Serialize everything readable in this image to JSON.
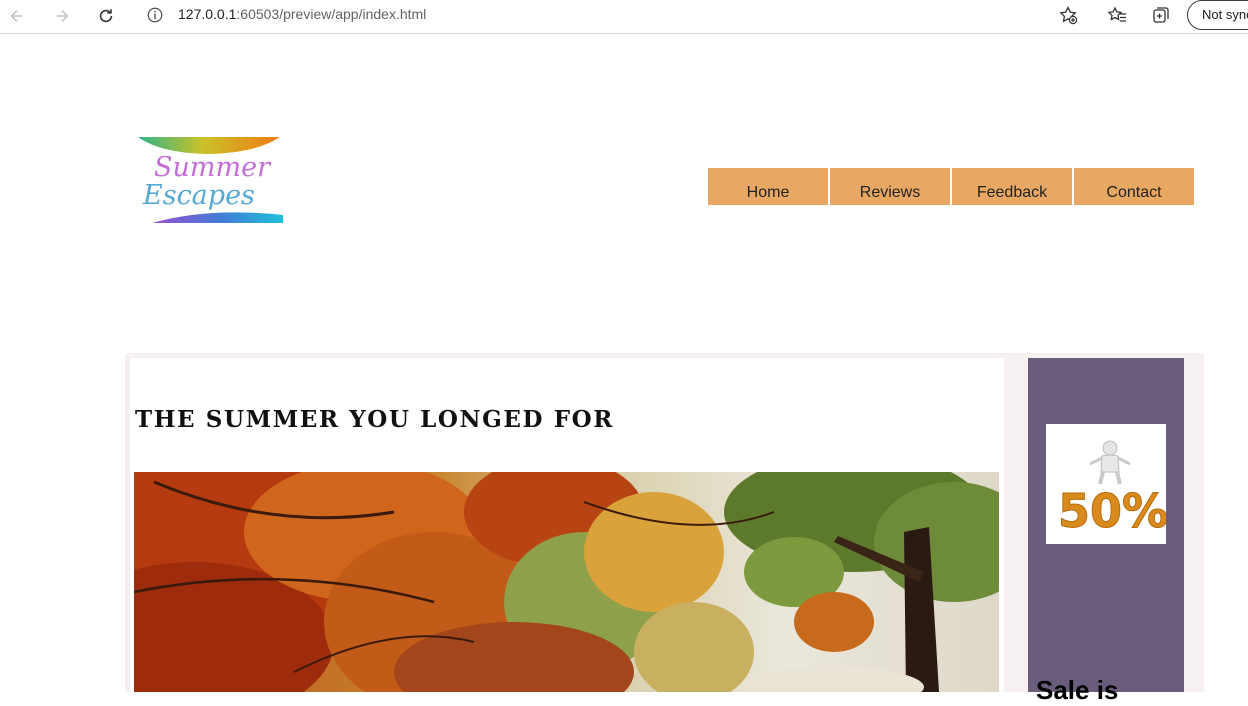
{
  "browser": {
    "url_host": "127.0.0.1",
    "url_rest": ":60503/preview/app/index.html",
    "profile_label": "Not sync"
  },
  "logo": {
    "text_line1": "Summer",
    "text_line2": "Escapes"
  },
  "nav": {
    "items": [
      {
        "label": "Home"
      },
      {
        "label": "Reviews"
      },
      {
        "label": "Feedback"
      },
      {
        "label": "Contact"
      }
    ]
  },
  "main": {
    "headline": "THE SUMMER YOU LONGED FOR"
  },
  "sidebar": {
    "promo_text": "50%",
    "sale_heading": "Sale is"
  },
  "colors": {
    "menu_bg": "#e8a762",
    "sidebar_bg": "#6a5c7d",
    "frame_bg": "#f7f0f1"
  }
}
